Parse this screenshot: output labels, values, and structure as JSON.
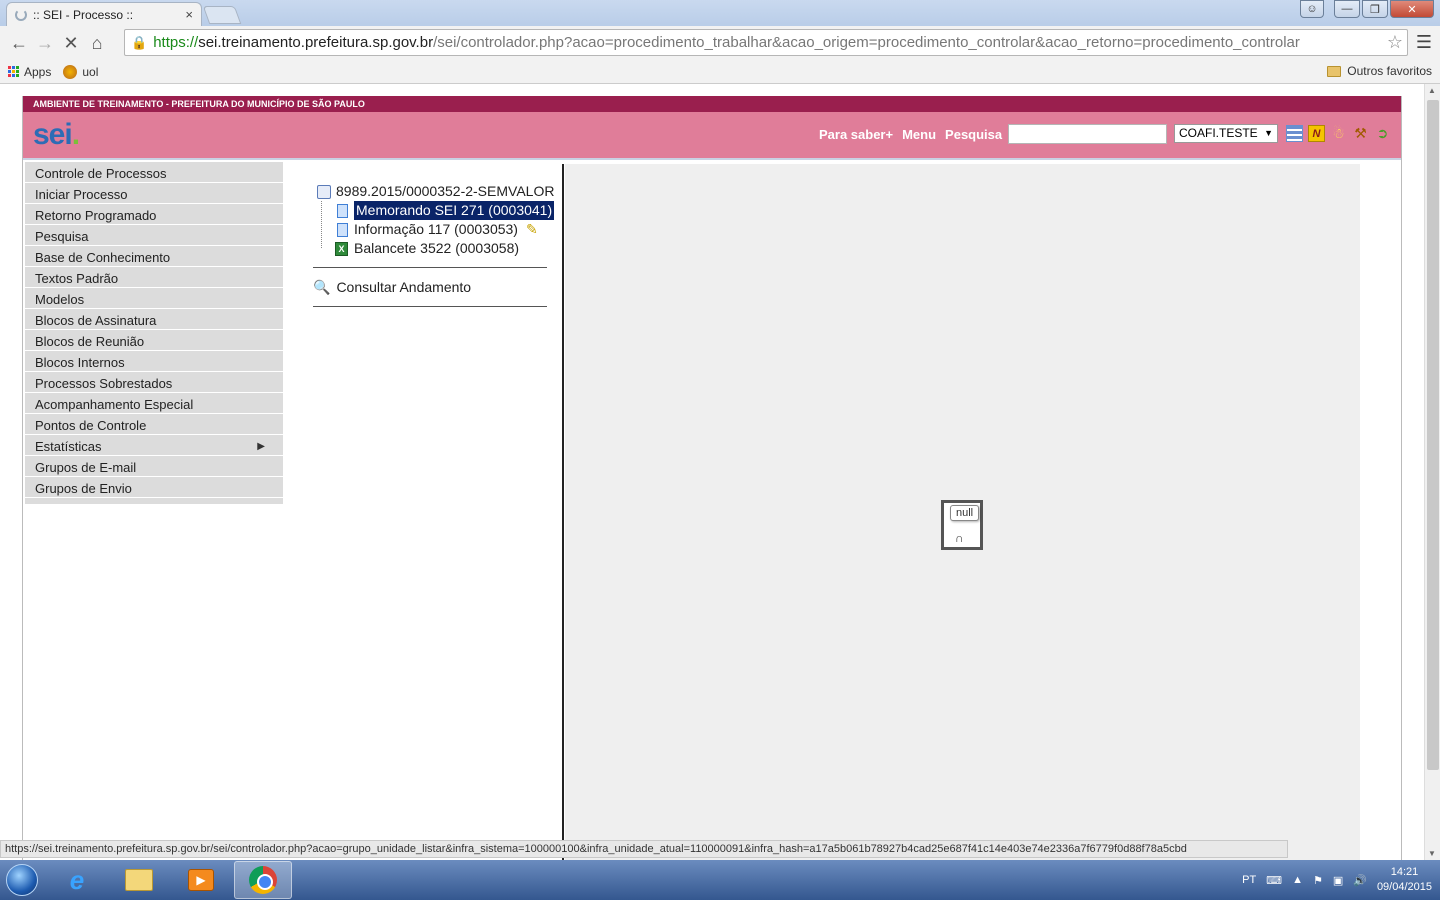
{
  "browser": {
    "tab_title": ":: SEI - Processo ::",
    "tab_close": "×",
    "url_scheme": "https://",
    "url_host": "sei.treinamento.prefeitura.sp.gov.br",
    "url_path": "/sei/controlador.php?acao=procedimento_trabalhar&acao_origem=procedimento_controlar&acao_retorno=procedimento_controlar",
    "bookmarks": [
      {
        "label": "Apps",
        "icon": "apps-grid-icon"
      },
      {
        "label": "uol",
        "icon": "uol-icon"
      }
    ],
    "other_bookmarks": "Outros favoritos"
  },
  "sei": {
    "environment_label": "AMBIENTE DE TREINAMENTO - PREFEITURA DO MUNICÍPIO DE SÃO PAULO",
    "logo_text": "sei",
    "logo_dot": ".",
    "top_links": [
      "Para saber+",
      "Menu",
      "Pesquisa"
    ],
    "search_value": "",
    "unit_selected": "COAFI.TESTE",
    "colors": {
      "env_bar": "#9a1f4e",
      "header": "#e07d99",
      "selected_tree": "#0a2468"
    }
  },
  "left_menu": [
    {
      "label": "Controle de Processos"
    },
    {
      "label": "Iniciar Processo"
    },
    {
      "label": "Retorno Programado"
    },
    {
      "label": "Pesquisa"
    },
    {
      "label": "Base de Conhecimento"
    },
    {
      "label": "Textos Padrão"
    },
    {
      "label": "Modelos"
    },
    {
      "label": "Blocos de Assinatura"
    },
    {
      "label": "Blocos de Reunião"
    },
    {
      "label": "Blocos Internos"
    },
    {
      "label": "Processos Sobrestados"
    },
    {
      "label": "Acompanhamento Especial"
    },
    {
      "label": "Pontos de Controle"
    },
    {
      "label": "Estatísticas",
      "has_submenu": true
    },
    {
      "label": "Grupos de E-mail"
    },
    {
      "label": "Grupos de Envio"
    }
  ],
  "tree": {
    "process": "8989.2015/0000352-2-SEMVALOR",
    "documents": [
      {
        "label": "Memorando SEI 271 (0003041)",
        "selected": true,
        "icon": "document-icon"
      },
      {
        "label": "Informação 117 (0003053)",
        "editable": true,
        "icon": "document-icon"
      },
      {
        "label": "Balancete 3522 (0003058)",
        "icon": "spreadsheet-icon"
      }
    ],
    "consult_label": "Consultar Andamento"
  },
  "viewer": {
    "tooltip": "null"
  },
  "status_bar_url": "https://sei.treinamento.prefeitura.sp.gov.br/sei/controlador.php?acao=grupo_unidade_listar&infra_sistema=100000100&infra_unidade_atual=110000091&infra_hash=a17a5b061b78927b4cad25e687f41c14e403e74e2336a7f6779f0d88f78a5cbd",
  "taskbar": {
    "language": "PT",
    "time": "14:21",
    "date": "09/04/2015"
  }
}
